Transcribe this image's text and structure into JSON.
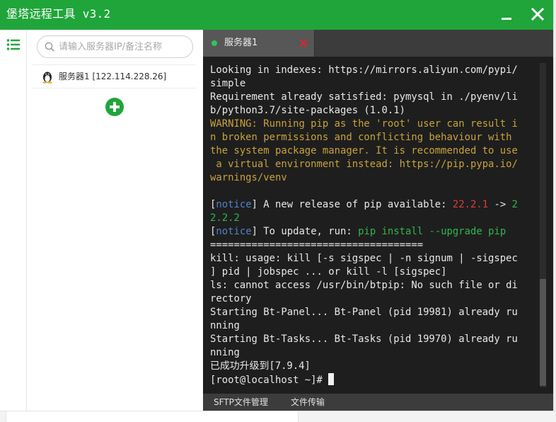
{
  "app": {
    "title": "堡塔远程工具 v3.2"
  },
  "sidebar": {
    "search_placeholder": "请输入服务器IP/备注名称",
    "servers": [
      {
        "label": "服务器1 [122.114.228.26]"
      }
    ]
  },
  "tabs": [
    {
      "label": "服务器1"
    }
  ],
  "terminal": {
    "lines": [
      {
        "segments": [
          {
            "text": "Looking in indexes: https://mirrors.aliyun.com/pypi/"
          }
        ]
      },
      {
        "segments": [
          {
            "text": "simple"
          }
        ]
      },
      {
        "segments": [
          {
            "text": "Requirement already satisfied: pymysql in ./pyenv/li"
          }
        ]
      },
      {
        "segments": [
          {
            "text": "b/python3.7/site-packages (1.0.1)"
          }
        ]
      },
      {
        "segments": [
          {
            "text": "WARNING: Running pip as the 'root' user can result i",
            "color": "warn"
          }
        ]
      },
      {
        "segments": [
          {
            "text": "n broken permissions and conflicting behaviour with ",
            "color": "warn"
          }
        ]
      },
      {
        "segments": [
          {
            "text": "the system package manager. It is recommended to use",
            "color": "warn"
          }
        ]
      },
      {
        "segments": [
          {
            "text": " a virtual environment instead: https://pip.pypa.io/",
            "color": "warn"
          }
        ]
      },
      {
        "segments": [
          {
            "text": "warnings/venv",
            "color": "warn"
          }
        ]
      },
      {
        "segments": [
          {
            "text": ""
          }
        ]
      },
      {
        "segments": [
          {
            "text": "["
          },
          {
            "text": "notice",
            "color": "blue"
          },
          {
            "text": "] A new release of pip available: "
          },
          {
            "text": "22.2.1",
            "color": "red"
          },
          {
            "text": " -> "
          },
          {
            "text": "2",
            "color": "green"
          }
        ]
      },
      {
        "segments": [
          {
            "text": "2.2.2",
            "color": "green"
          }
        ]
      },
      {
        "segments": [
          {
            "text": "["
          },
          {
            "text": "notice",
            "color": "blue"
          },
          {
            "text": "] To update, run: "
          },
          {
            "text": "pip install --upgrade pip",
            "color": "green"
          }
        ]
      },
      {
        "segments": [
          {
            "text": "===================================="
          }
        ]
      },
      {
        "segments": [
          {
            "text": "kill: usage: kill [-s sigspec | -n signum | -sigspec"
          }
        ]
      },
      {
        "segments": [
          {
            "text": "] pid | jobspec ... or kill -l [sigspec]"
          }
        ]
      },
      {
        "segments": [
          {
            "text": "ls: cannot access /usr/bin/btpip: No such file or di"
          }
        ]
      },
      {
        "segments": [
          {
            "text": "rectory"
          }
        ]
      },
      {
        "segments": [
          {
            "text": "Starting Bt-Panel... Bt-Panel (pid 19981) already ru"
          }
        ]
      },
      {
        "segments": [
          {
            "text": "nning"
          }
        ]
      },
      {
        "segments": [
          {
            "text": "Starting Bt-Tasks... Bt-Tasks (pid 19970) already ru"
          }
        ]
      },
      {
        "segments": [
          {
            "text": "nning"
          }
        ]
      },
      {
        "segments": [
          {
            "text": "已成功升级到[7.9.4]"
          }
        ]
      },
      {
        "segments": [
          {
            "text": "[root@localhost ~]# "
          }
        ],
        "cursor": true
      }
    ]
  },
  "bottom_tabs": [
    {
      "label": "SFTP文件管理"
    },
    {
      "label": "文件传输"
    }
  ],
  "icons": {
    "menu": "list-menu-icon",
    "minimize": "minimize-icon",
    "close": "close-icon",
    "search": "search-icon",
    "server_os": "linux-tux-icon",
    "add": "plus-circle-icon",
    "tab_close": "close-x-icon"
  },
  "colors": {
    "brand_green": "#20a53a",
    "terminal_bg": "#1e1e1e",
    "terminal_text": "#e8e8e8",
    "warning_text": "#c8a33a",
    "notice_blue": "#4f82cc",
    "version_red": "#e03a3a",
    "command_green": "#2fb64f",
    "tab_close_red": "#e02424"
  }
}
